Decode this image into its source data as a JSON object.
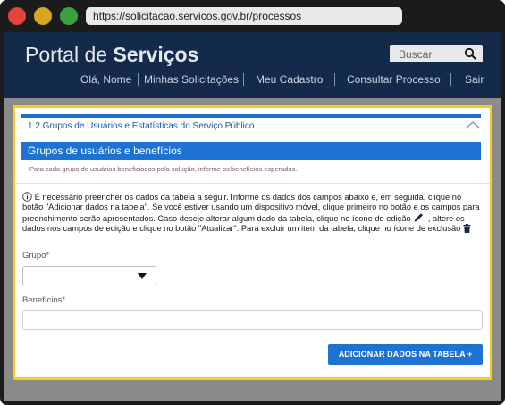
{
  "browser": {
    "url": "https://solicitacao.servicos.gov.br/processos"
  },
  "header": {
    "brand_light": "Portal de ",
    "brand_bold": "Serviços",
    "search_placeholder": "Buscar",
    "nav": [
      {
        "label": "Olá, Nome"
      },
      {
        "label": "Minhas Solicitações"
      },
      {
        "label": "Meu Cadastro"
      },
      {
        "label": "Consultar Processo"
      },
      {
        "label": "Sair"
      }
    ]
  },
  "section": {
    "title": "1.2 Grupos de Usuários e Estatísticas do Serviço Público"
  },
  "group": {
    "title": "Grupos de usuários e benefícios",
    "subtitle": "Para cada grupo de usuários beneficiados pela solução, informe os benefícios esperados."
  },
  "info": {
    "text_before_edit": "É necessário preencher os dados da tabela a seguir. Informe os dados dos campos abaixo e, em seguida, clique no botão \"Adicionar dados na tabela\". Se você estiver usando um dispositivo móvel, clique primeiro no botão e os campos para preenchimento serão apresentados. Caso deseje alterar algum dado da tabela, clique no ícone de edição",
    "text_after_edit": ", altere os dados nos campos de edição e clique no botão \"Atualizar\". Para excluir um item da tabela, clique no ícone de exclusão"
  },
  "form": {
    "grupo_label": "Grupo",
    "grupo_value": "",
    "beneficios_label": "Benefícios",
    "beneficios_value": "",
    "required_mark": "*",
    "add_button": "ADICIONAR DADOS NA TABELA +"
  },
  "colors": {
    "header_bg": "#142a4b",
    "accent_blue": "#1e73d2",
    "focus_outline": "#f5cf1c"
  },
  "icons": [
    "search-icon",
    "chevron-up-icon",
    "info-icon",
    "pencil-icon",
    "trash-icon",
    "dropdown-arrow-icon"
  ]
}
